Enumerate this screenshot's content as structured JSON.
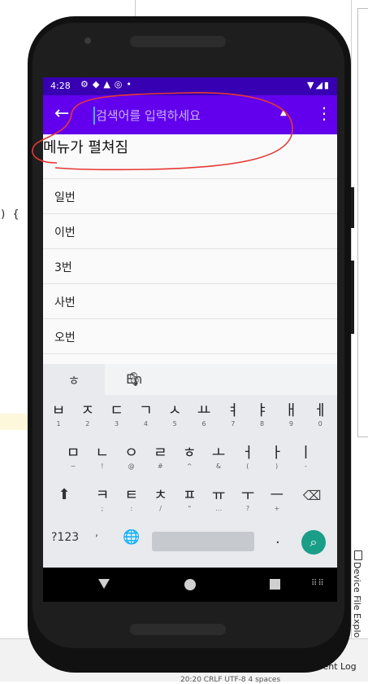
{
  "ide": {
    "code_fragment": ") {",
    "device_file_explorer": "Device File Explorer",
    "event_log": "Event Log",
    "bottom_status": "20:20  CRLF  UTF-8  4 spaces"
  },
  "status_bar": {
    "time": "4:28",
    "icons": [
      "gear-icon",
      "shield-icon",
      "a-icon",
      "at-icon",
      "dot-icon"
    ],
    "right_icons": [
      "wifi-icon",
      "signal-icon",
      "battery-icon"
    ]
  },
  "app_bar": {
    "back_icon": "arrow-back-icon",
    "search_placeholder": "검색어를 입력하세요",
    "overflow_icon": "more-vert-icon"
  },
  "heading": "메뉴가 펼쳐짐",
  "list": [
    "일번",
    "이번",
    "3번",
    "사번",
    "오번"
  ],
  "keyboard": {
    "mode_hangul": "ㅎ",
    "mode_en": "En",
    "row1": [
      {
        "k": "ㅂ",
        "s": "1"
      },
      {
        "k": "ㅈ",
        "s": "2"
      },
      {
        "k": "ㄷ",
        "s": "3"
      },
      {
        "k": "ㄱ",
        "s": "4"
      },
      {
        "k": "ㅅ",
        "s": "5"
      },
      {
        "k": "ㅛ",
        "s": "6"
      },
      {
        "k": "ㅕ",
        "s": "7"
      },
      {
        "k": "ㅑ",
        "s": "8"
      },
      {
        "k": "ㅐ",
        "s": "9"
      },
      {
        "k": "ㅔ",
        "s": "0"
      }
    ],
    "row2": [
      {
        "k": "ㅁ",
        "s": "~"
      },
      {
        "k": "ㄴ",
        "s": "!"
      },
      {
        "k": "ㅇ",
        "s": "@"
      },
      {
        "k": "ㄹ",
        "s": "#"
      },
      {
        "k": "ㅎ",
        "s": "^"
      },
      {
        "k": "ㅗ",
        "s": "&"
      },
      {
        "k": "ㅓ",
        "s": "("
      },
      {
        "k": "ㅏ",
        "s": ")"
      },
      {
        "k": "ㅣ",
        "s": "-"
      }
    ],
    "row3": [
      {
        "k": "ㅋ",
        "s": ";"
      },
      {
        "k": "ㅌ",
        "s": ":"
      },
      {
        "k": "ㅊ",
        "s": "/"
      },
      {
        "k": "ㅍ",
        "s": "\""
      },
      {
        "k": "ㅠ",
        "s": "…"
      },
      {
        "k": "ㅜ",
        "s": "?"
      },
      {
        "k": "ㅡ",
        "s": "+"
      }
    ],
    "sym_label": "?123",
    "comma": ",",
    "period": "."
  },
  "colors": {
    "status_bar": "#3700b3",
    "app_bar": "#6200ee",
    "annotation": "#e53935",
    "search_key": "#1a9e88"
  }
}
